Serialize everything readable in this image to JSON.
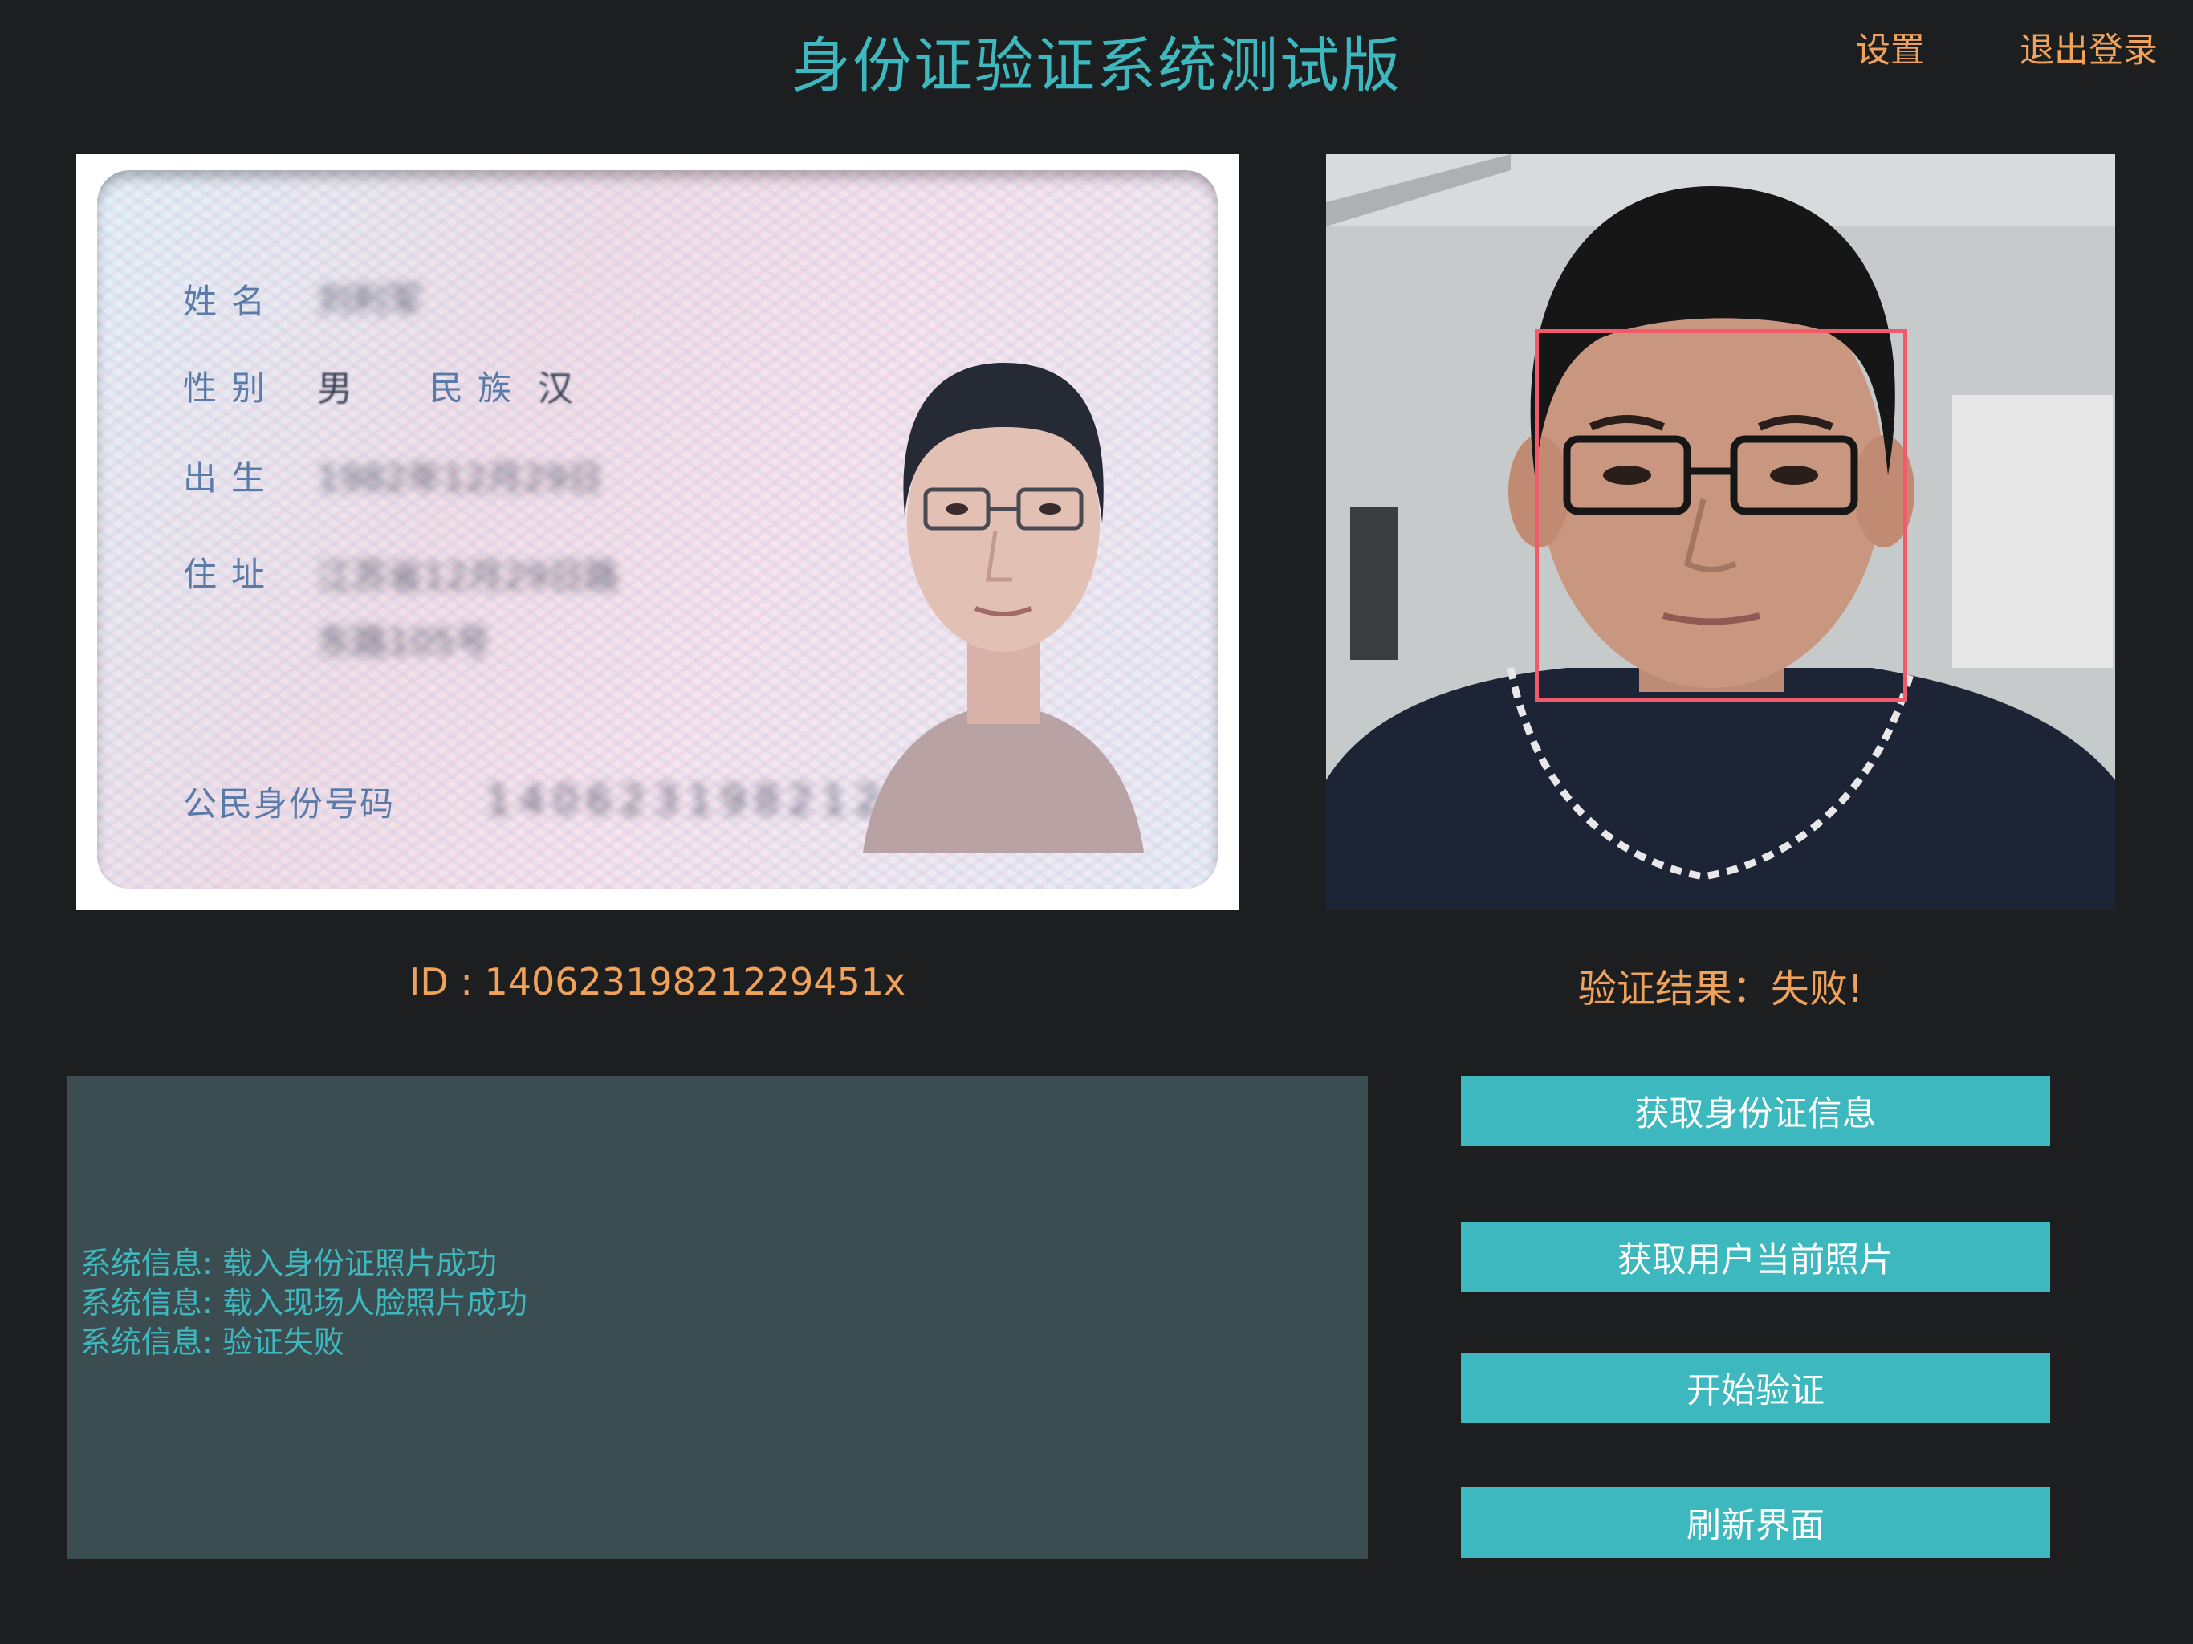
{
  "header": {
    "title": "身份证验证系统测试版",
    "settings_label": "设置",
    "logout_label": "退出登录"
  },
  "id_card": {
    "fields": [
      {
        "label": "姓名",
        "value": "刘利军"
      },
      {
        "label": "性别",
        "value": "男"
      },
      {
        "label": "民族",
        "value": "汉"
      },
      {
        "label": "出生",
        "value": "1982年12月29日"
      },
      {
        "label": "住址",
        "value": "江苏省12月29日路"
      },
      {
        "label": "",
        "value": "东路105号"
      }
    ],
    "number_label": "公民身份号码",
    "number_value": "14062319821229451x"
  },
  "id_readout": "ID : 14062319821229451x",
  "result": {
    "label": "验证结果：",
    "value": "失败!"
  },
  "log": {
    "lines": [
      "系统信息: 载入身份证照片成功",
      "系统信息: 载入现场人脸照片成功",
      "系统信息: 验证失败"
    ]
  },
  "actions": {
    "get_id": "获取身份证信息",
    "get_photo": "获取用户当前照片",
    "verify": "开始验证",
    "refresh": "刷新界面"
  },
  "colors": {
    "background": "#1d1e20",
    "accent": "#3db8be",
    "highlight": "#f0a25a",
    "face_box": "#f05a6a",
    "log_bg": "#3b4d51"
  }
}
